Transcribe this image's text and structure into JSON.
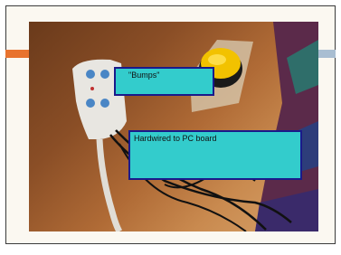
{
  "annotations": {
    "bumps": "\"Bumps\"",
    "hardwired": "Hardwired to PC board"
  },
  "colors": {
    "accent_orange": "#e8732e",
    "accent_blue": "#a9bed2",
    "label_fill": "#33cccc",
    "label_border": "#1a1a8a"
  }
}
